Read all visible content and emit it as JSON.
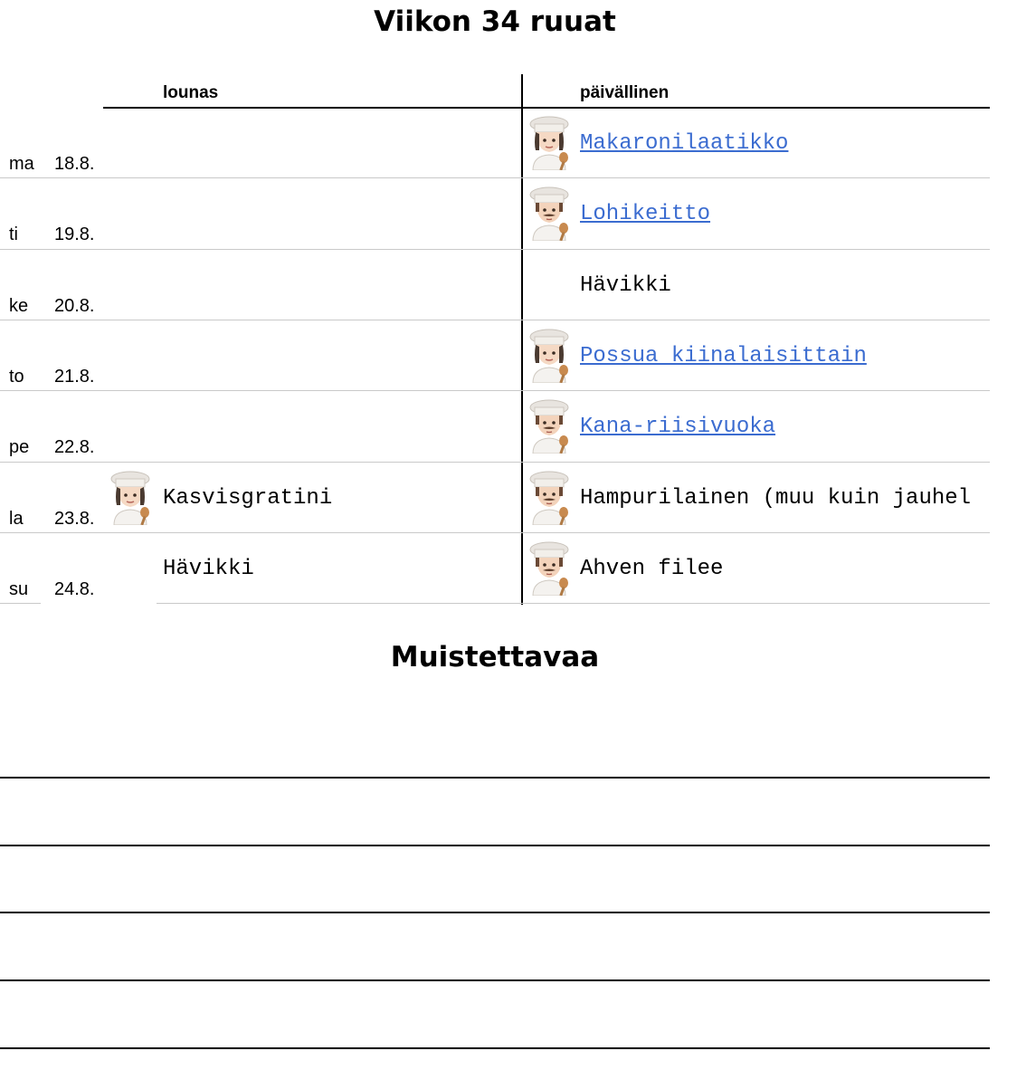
{
  "title": "Viikon 34 ruuat",
  "columns": {
    "lunch": "lounas",
    "dinner": "päivällinen"
  },
  "days": [
    {
      "day": "ma",
      "date": "18.8.",
      "lunch": null,
      "dinner": {
        "text": "Makaronilaatikko",
        "link": true,
        "cook": "woman-cook-icon"
      }
    },
    {
      "day": "ti",
      "date": "19.8.",
      "lunch": null,
      "dinner": {
        "text": "Lohikeitto",
        "link": true,
        "cook": "man-cook-icon"
      }
    },
    {
      "day": "ke",
      "date": "20.8.",
      "lunch": null,
      "dinner": {
        "text": "Hävikki",
        "link": false,
        "cook": null
      }
    },
    {
      "day": "to",
      "date": "21.8.",
      "lunch": null,
      "dinner": {
        "text": "Possua kiinalaisittain",
        "link": true,
        "cook": "woman-cook-icon"
      }
    },
    {
      "day": "pe",
      "date": "22.8.",
      "lunch": null,
      "dinner": {
        "text": "Kana-riisivuoka",
        "link": true,
        "cook": "man-cook-icon"
      }
    },
    {
      "day": "la",
      "date": "23.8.",
      "lunch": {
        "text": "Kasvisgratini",
        "link": false,
        "cook": "woman-cook-icon"
      },
      "dinner": {
        "text": "Hampurilainen (muu kuin jauhel",
        "link": false,
        "cook": "man-cook-icon"
      }
    },
    {
      "day": "su",
      "date": "24.8.",
      "lunch": {
        "text": "Hävikki",
        "link": false,
        "cook": null
      },
      "dinner": {
        "text": "Ahven filee",
        "link": false,
        "cook": "man-cook-icon"
      }
    }
  ],
  "notes_title": "Muistettavaa"
}
